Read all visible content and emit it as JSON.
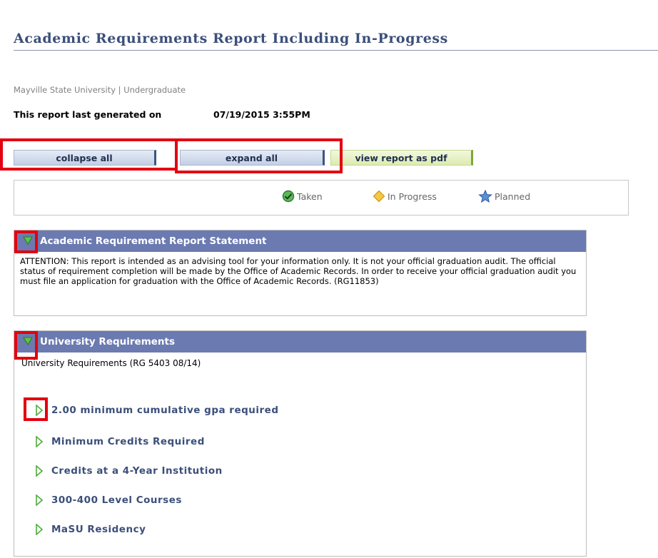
{
  "page": {
    "title": "Academic Requirements Report Including In-Progress",
    "institution": "Mayville State University | Undergraduate",
    "generated_label": "This report last generated on",
    "generated_value": "07/19/2015  3:55PM"
  },
  "buttons": {
    "collapse": "collapse all",
    "expand": "expand all",
    "pdf": "view report as pdf"
  },
  "legend": {
    "taken": "Taken",
    "in_progress": "In Progress",
    "planned": "Planned"
  },
  "statement": {
    "header": "Academic Requirement Report Statement",
    "body": "ATTENTION: This report is intended as an advising tool for your information only. It is not your official graduation audit. The official status of requirement completion will be made by the Office of Academic Records. In order to receive your official graduation audit you must file an application for graduation with the Office of Academic Records. (RG11853)"
  },
  "university": {
    "header": "University Requirements",
    "subtitle": "University Requirements (RG 5403 08/14)",
    "items": [
      {
        "label": "2.00 minimum cumulative gpa required"
      },
      {
        "label": "Minimum Credits Required"
      },
      {
        "label": "Credits at a 4-Year Institution"
      },
      {
        "label": "300-400 Level Courses"
      },
      {
        "label": "MaSU Residency"
      }
    ]
  },
  "colors": {
    "header_bg": "#6b7ab0",
    "title": "#3b4f7a",
    "highlight": "#e3000f",
    "arrow": "#4fae3c"
  }
}
